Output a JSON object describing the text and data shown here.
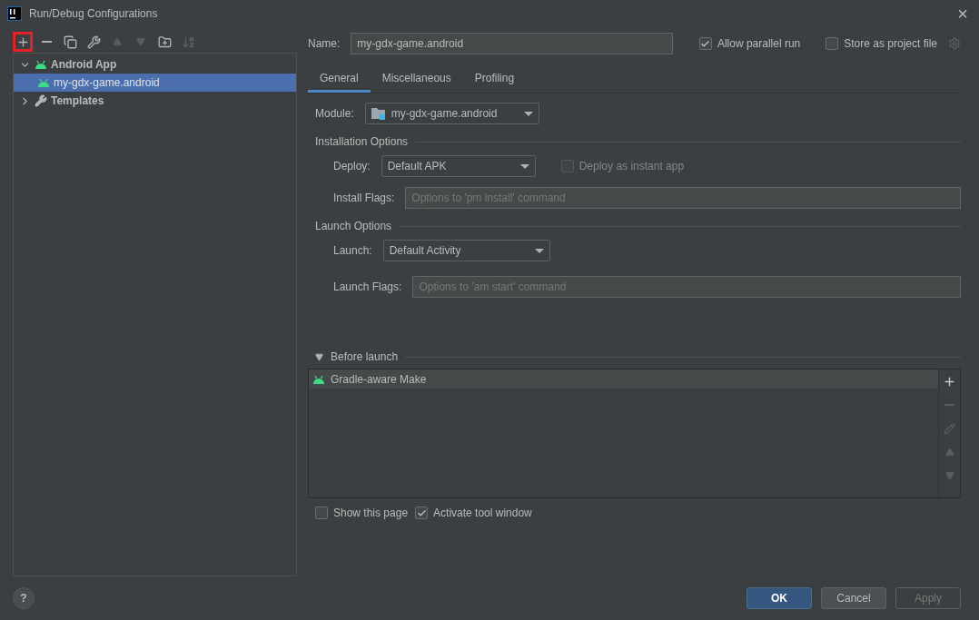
{
  "window": {
    "title": "Run/Debug Configurations",
    "close": "×"
  },
  "toolbar": [
    {
      "kind": "add",
      "disabled": false,
      "highlighted": true
    },
    {
      "kind": "remove",
      "disabled": false,
      "highlighted": false
    },
    {
      "kind": "copy",
      "disabled": false,
      "highlighted": false
    },
    {
      "kind": "wrench",
      "disabled": false,
      "highlighted": false
    },
    {
      "kind": "up",
      "disabled": true,
      "highlighted": false
    },
    {
      "kind": "down",
      "disabled": true,
      "highlighted": false
    },
    {
      "kind": "folder",
      "disabled": false,
      "highlighted": false
    },
    {
      "kind": "sort",
      "disabled": true,
      "highlighted": false
    }
  ],
  "tree": [
    {
      "label": "Android App",
      "kind": "android",
      "expanded": true,
      "selected": false,
      "children": [
        {
          "label": "my-gdx-game.android",
          "kind": "android",
          "selected": true
        }
      ]
    },
    {
      "label": "Templates",
      "kind": "wrench",
      "expanded": false,
      "selected": false
    }
  ],
  "name": {
    "label": "Name:",
    "value": "my-gdx-game.android"
  },
  "header_options": [
    {
      "label": "Allow parallel run",
      "checked": true
    },
    {
      "label": "Store as project file",
      "checked": false
    }
  ],
  "tabs": [
    {
      "label": "General",
      "selected": true
    },
    {
      "label": "Miscellaneous",
      "selected": false
    },
    {
      "label": "Profiling",
      "selected": false
    }
  ],
  "module": {
    "label": "Module:",
    "value": "my-gdx-game.android"
  },
  "installation": {
    "title": "Installation Options",
    "deploy": {
      "label": "Deploy:",
      "value": "Default APK"
    },
    "instant_app": {
      "label": "Deploy as instant app",
      "checked": false,
      "disabled": true
    },
    "install_flags": {
      "label": "Install Flags:",
      "placeholder": "Options to 'pm install' command"
    }
  },
  "launch": {
    "title": "Launch Options",
    "launch": {
      "label": "Launch:",
      "value": "Default Activity"
    },
    "launch_flags": {
      "label": "Launch Flags:",
      "placeholder": "Options to 'am start' command"
    }
  },
  "before_launch": {
    "title": "Before launch",
    "expanded": true,
    "tasks": [
      {
        "label": "Gradle-aware Make",
        "selected": true
      }
    ],
    "actions": [
      {
        "kind": "add",
        "disabled": false
      },
      {
        "kind": "remove",
        "disabled": true
      },
      {
        "kind": "edit",
        "disabled": true
      },
      {
        "kind": "up",
        "disabled": true
      },
      {
        "kind": "down",
        "disabled": true
      }
    ]
  },
  "bottom_options": [
    {
      "label": "Show this page",
      "checked": false
    },
    {
      "label": "Activate tool window",
      "checked": true
    }
  ],
  "help": "?",
  "buttons": [
    {
      "label": "OK",
      "kind": "primary",
      "disabled": false
    },
    {
      "label": "Cancel",
      "kind": "normal",
      "disabled": false
    },
    {
      "label": "Apply",
      "kind": "normal",
      "disabled": true
    }
  ]
}
